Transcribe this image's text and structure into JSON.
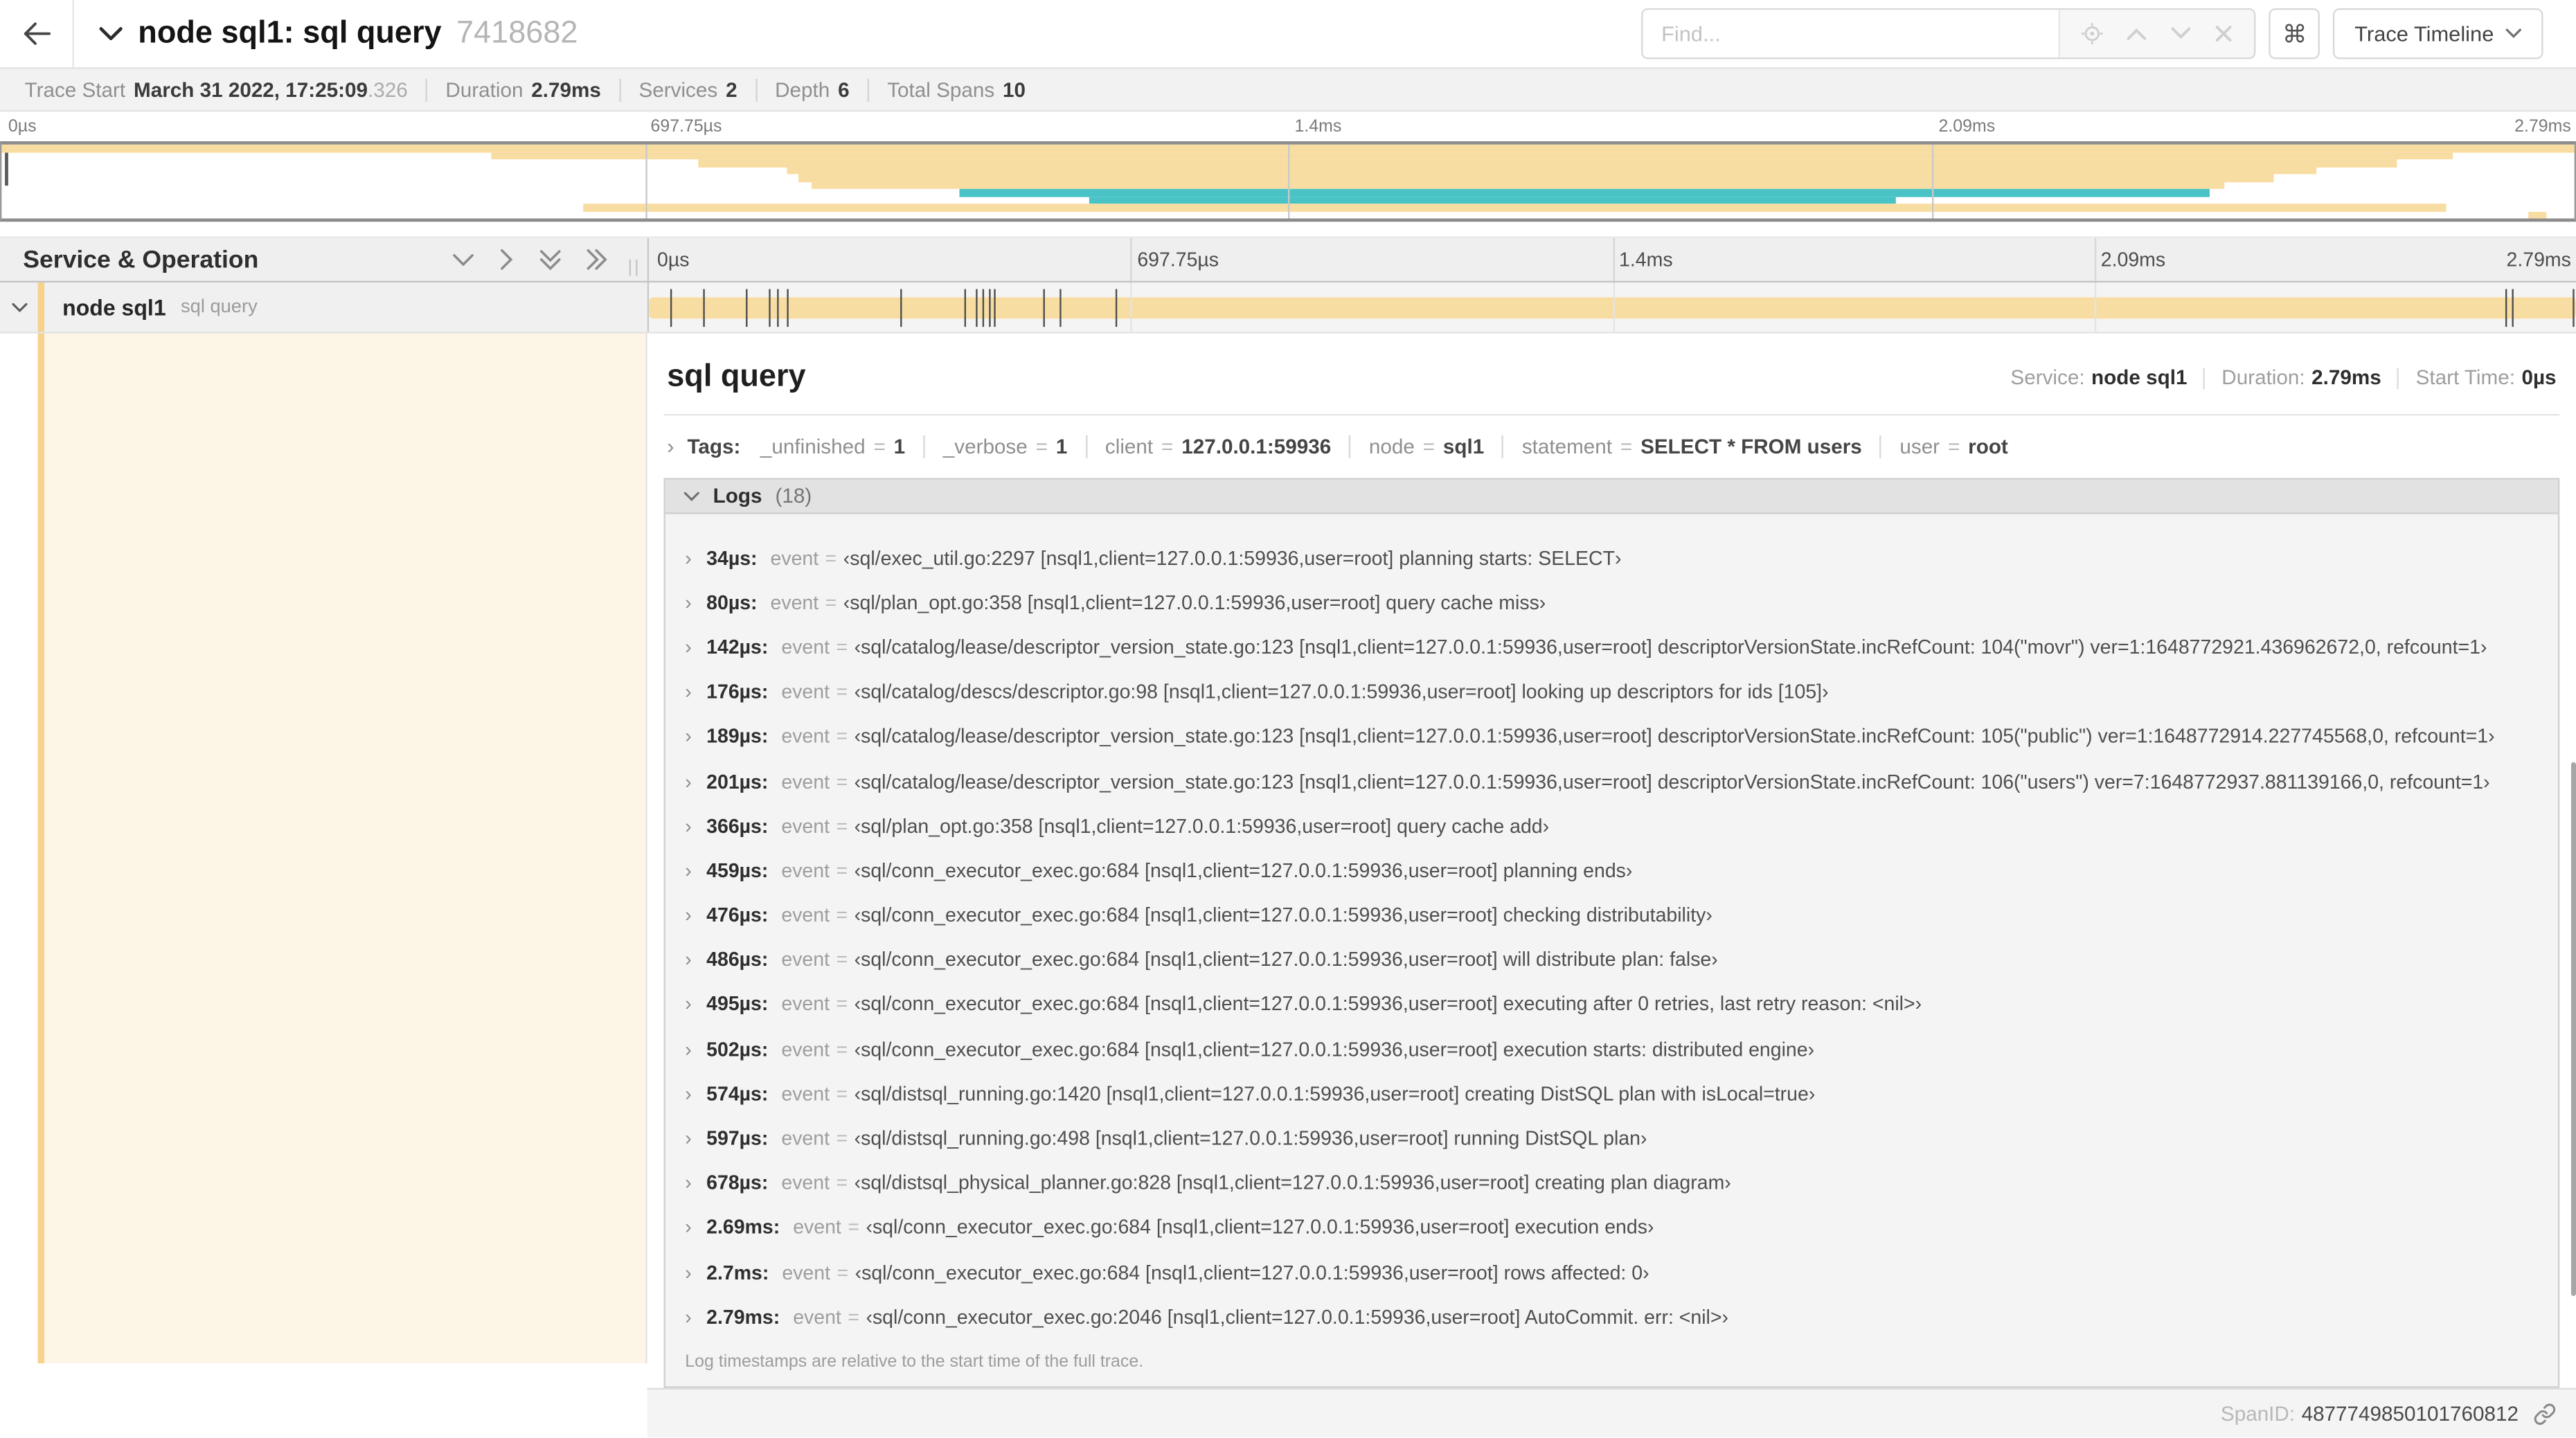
{
  "colors": {
    "span_orange": "#f8dda2",
    "span_teal": "#4ac3c6",
    "accent_stripe": "#f6d28c",
    "detail_background": "#fdf6e7"
  },
  "header": {
    "title": "node sql1: sql query",
    "trace_id": "7418682",
    "find_placeholder": "Find...",
    "keyboard_shortcut": "⌘",
    "view_selector": "Trace Timeline"
  },
  "stats": {
    "trace_start_label": "Trace Start",
    "trace_start_value": "March 31 2022, 17:25:09",
    "trace_start_fraction": ".326",
    "duration_label": "Duration",
    "duration_value": "2.79ms",
    "services_label": "Services",
    "services_value": "2",
    "depth_label": "Depth",
    "depth_value": "6",
    "total_spans_label": "Total Spans",
    "total_spans_value": "10"
  },
  "timeline": {
    "total_us": 2790,
    "ticks": [
      {
        "label": "0µs",
        "pos": 0
      },
      {
        "label": "697.75µs",
        "pos": 25
      },
      {
        "label": "1.4ms",
        "pos": 50
      },
      {
        "label": "2.09ms",
        "pos": 75
      },
      {
        "label": "2.79ms",
        "pos": 100
      }
    ],
    "column_title": "Service & Operation"
  },
  "minimap": {
    "spans": [
      {
        "start": 0,
        "end": 100,
        "color": "orange"
      },
      {
        "start": 19,
        "end": 95.3,
        "color": "orange"
      },
      {
        "start": 27.1,
        "end": 93.1,
        "color": "orange"
      },
      {
        "start": 30.5,
        "end": 90,
        "color": "orange"
      },
      {
        "start": 31,
        "end": 88.3,
        "color": "orange"
      },
      {
        "start": 31.5,
        "end": 86.4,
        "color": "orange"
      },
      {
        "start": 37.2,
        "end": 85.8,
        "color": "teal"
      },
      {
        "start": 42.3,
        "end": 73.6,
        "color": "teal"
      },
      {
        "start": 22.6,
        "end": 95,
        "color": "orange"
      },
      {
        "start": 98.2,
        "end": 98.9,
        "color": "orange"
      }
    ]
  },
  "row": {
    "service": "node sql1",
    "operation": "sql query"
  },
  "detail": {
    "title": "sql query",
    "service_label": "Service:",
    "service": "node sql1",
    "duration_label": "Duration:",
    "duration": "2.79ms",
    "start_label": "Start Time:",
    "start": "0µs",
    "tags_label": "Tags:",
    "tags": [
      {
        "key": "_unfinished",
        "value": "1"
      },
      {
        "key": "_verbose",
        "value": "1"
      },
      {
        "key": "client",
        "value": "127.0.0.1:59936"
      },
      {
        "key": "node",
        "value": "sql1"
      },
      {
        "key": "statement",
        "value": "SELECT * FROM users"
      },
      {
        "key": "user",
        "value": "root"
      }
    ],
    "logs_label": "Logs",
    "logs_count": "(18)",
    "logs": [
      {
        "time": "34µs:",
        "us": 34,
        "key": "event",
        "value": "‹sql/exec_util.go:2297 [nsql1,client=127.0.0.1:59936,user=root] planning starts: SELECT›"
      },
      {
        "time": "80µs:",
        "us": 80,
        "key": "event",
        "value": "‹sql/plan_opt.go:358 [nsql1,client=127.0.0.1:59936,user=root] query cache miss›"
      },
      {
        "time": "142µs:",
        "us": 142,
        "key": "event",
        "value": "‹sql/catalog/lease/descriptor_version_state.go:123 [nsql1,client=127.0.0.1:59936,user=root] descriptorVersionState.incRefCount: 104(\"movr\") ver=1:1648772921.436962672,0, refcount=1›"
      },
      {
        "time": "176µs:",
        "us": 176,
        "key": "event",
        "value": "‹sql/catalog/descs/descriptor.go:98 [nsql1,client=127.0.0.1:59936,user=root] looking up descriptors for ids [105]›"
      },
      {
        "time": "189µs:",
        "us": 189,
        "key": "event",
        "value": "‹sql/catalog/lease/descriptor_version_state.go:123 [nsql1,client=127.0.0.1:59936,user=root] descriptorVersionState.incRefCount: 105(\"public\") ver=1:1648772914.227745568,0, refcount=1›"
      },
      {
        "time": "201µs:",
        "us": 201,
        "key": "event",
        "value": "‹sql/catalog/lease/descriptor_version_state.go:123 [nsql1,client=127.0.0.1:59936,user=root] descriptorVersionState.incRefCount: 106(\"users\") ver=7:1648772937.881139166,0, refcount=1›"
      },
      {
        "time": "366µs:",
        "us": 366,
        "key": "event",
        "value": "‹sql/plan_opt.go:358 [nsql1,client=127.0.0.1:59936,user=root] query cache add›"
      },
      {
        "time": "459µs:",
        "us": 459,
        "key": "event",
        "value": "‹sql/conn_executor_exec.go:684 [nsql1,client=127.0.0.1:59936,user=root] planning ends›"
      },
      {
        "time": "476µs:",
        "us": 476,
        "key": "event",
        "value": "‹sql/conn_executor_exec.go:684 [nsql1,client=127.0.0.1:59936,user=root] checking distributability›"
      },
      {
        "time": "486µs:",
        "us": 486,
        "key": "event",
        "value": "‹sql/conn_executor_exec.go:684 [nsql1,client=127.0.0.1:59936,user=root] will distribute plan: false›"
      },
      {
        "time": "495µs:",
        "us": 495,
        "key": "event",
        "value": "‹sql/conn_executor_exec.go:684 [nsql1,client=127.0.0.1:59936,user=root] executing after 0 retries, last retry reason: <nil>›"
      },
      {
        "time": "502µs:",
        "us": 502,
        "key": "event",
        "value": "‹sql/conn_executor_exec.go:684 [nsql1,client=127.0.0.1:59936,user=root] execution starts: distributed engine›"
      },
      {
        "time": "574µs:",
        "us": 574,
        "key": "event",
        "value": "‹sql/distsql_running.go:1420 [nsql1,client=127.0.0.1:59936,user=root] creating DistSQL plan with isLocal=true›"
      },
      {
        "time": "597µs:",
        "us": 597,
        "key": "event",
        "value": "‹sql/distsql_running.go:498 [nsql1,client=127.0.0.1:59936,user=root] running DistSQL plan›"
      },
      {
        "time": "678µs:",
        "us": 678,
        "key": "event",
        "value": "‹sql/distsql_physical_planner.go:828 [nsql1,client=127.0.0.1:59936,user=root] creating plan diagram›"
      },
      {
        "time": "2.69ms:",
        "us": 2690,
        "key": "event",
        "value": "‹sql/conn_executor_exec.go:684 [nsql1,client=127.0.0.1:59936,user=root] execution ends›"
      },
      {
        "time": "2.7ms:",
        "us": 2700,
        "key": "event",
        "value": "‹sql/conn_executor_exec.go:684 [nsql1,client=127.0.0.1:59936,user=root] rows affected: 0›"
      },
      {
        "time": "2.79ms:",
        "us": 2790,
        "key": "event",
        "value": "‹sql/conn_executor_exec.go:2046 [nsql1,client=127.0.0.1:59936,user=root] AutoCommit. err: <nil>›"
      }
    ],
    "logs_note": "Log timestamps are relative to the start time of the full trace.",
    "span_id_label": "SpanID:",
    "span_id": "4877749850101760812"
  }
}
